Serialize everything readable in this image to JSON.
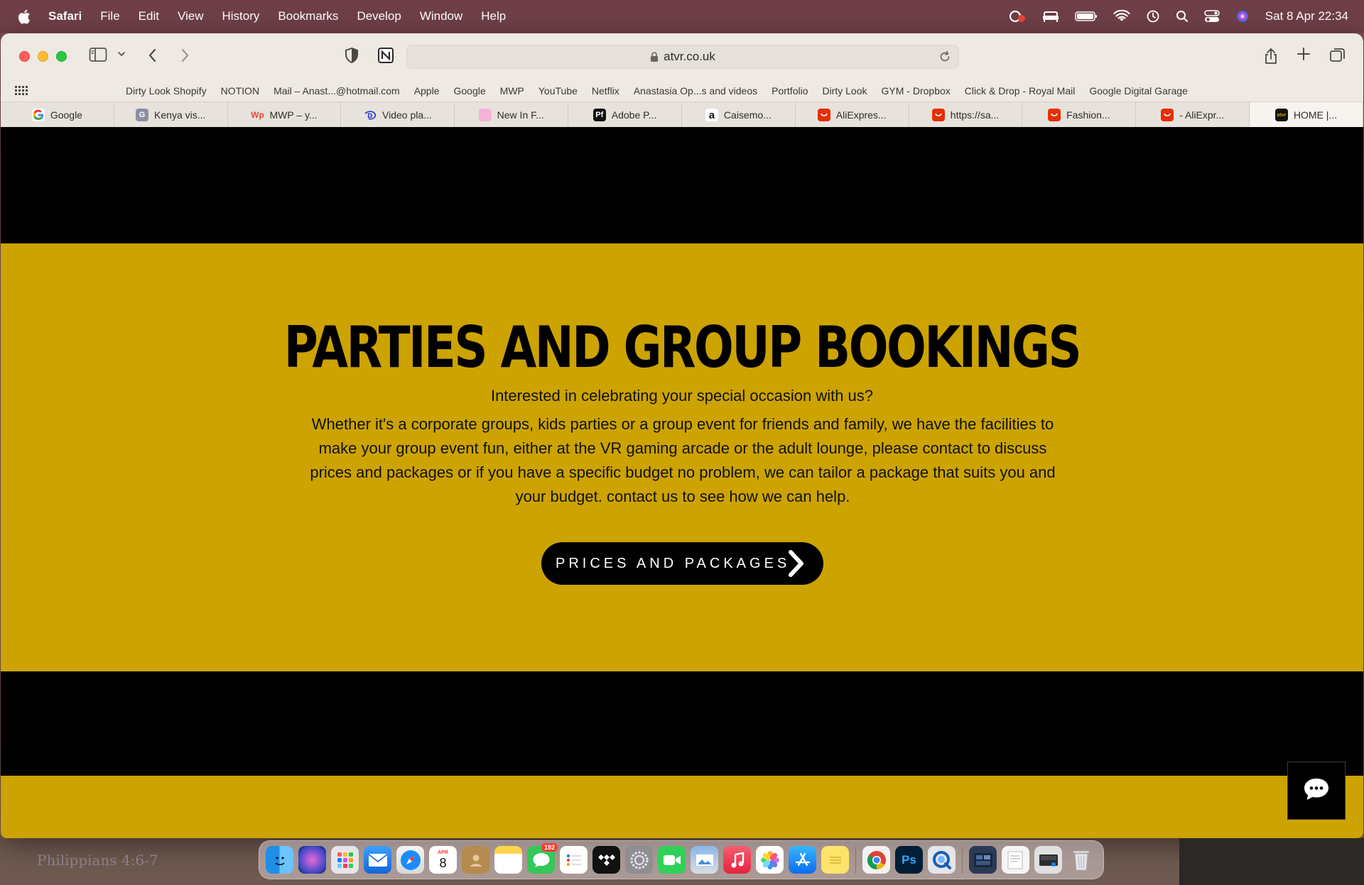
{
  "menubar": {
    "app_name": "Safari",
    "items": [
      "File",
      "Edit",
      "View",
      "History",
      "Bookmarks",
      "Develop",
      "Window",
      "Help"
    ],
    "clock": "Sat 8 Apr  22:34"
  },
  "browser": {
    "address": "atvr.co.uk",
    "bookmarks": [
      "Dirty Look Shopify",
      "NOTION",
      "Mail – Anast...@hotmail.com",
      "Apple",
      "Google",
      "MWP",
      "YouTube",
      "Netflix",
      "Anastasia Op...s and videos",
      "Portfolio",
      "Dirty Look",
      "GYM - Dropbox",
      "Click & Drop - Royal Mail",
      "Google Digital Garage"
    ],
    "tabs": [
      {
        "label": "Google",
        "icon": "google-icon",
        "color": "#ffffff"
      },
      {
        "label": "Kenya vis...",
        "icon": "g-letter-icon",
        "color": "#8d8fa6"
      },
      {
        "label": "MWP – y...",
        "icon": "mwp-icon",
        "color": "#e8453c"
      },
      {
        "label": "Video pla...",
        "icon": "disney-icon",
        "color": "#2b3fd6"
      },
      {
        "label": "New In F...",
        "icon": "pink-square-icon",
        "color": "#f5b4d6"
      },
      {
        "label": "Adobe P...",
        "icon": "pf-icon",
        "color": "#111111"
      },
      {
        "label": "Caisemo...",
        "icon": "amazon-icon",
        "color": "#ffffff"
      },
      {
        "label": "AliExpres...",
        "icon": "aliexpress-icon",
        "color": "#e62e04"
      },
      {
        "label": "https://sa...",
        "icon": "aliexpress-icon",
        "color": "#e62e04"
      },
      {
        "label": "Fashion...",
        "icon": "aliexpress-icon",
        "color": "#e62e04"
      },
      {
        "label": "- AliExpr...",
        "icon": "aliexpress-icon",
        "color": "#e62e04"
      },
      {
        "label": "HOME |...",
        "icon": "atvr-icon",
        "color": "#111111"
      }
    ]
  },
  "page": {
    "heading": "PARTIES AND GROUP BOOKINGS",
    "lead": "Interested in celebrating your special occasion with us?",
    "body": "Whether it's a corporate groups, kids parties or a group event for friends and family, we have the facilities to make your group event fun, either at the VR gaming arcade or the adult lounge, please contact to discuss prices and packages or if you have a specific budget no problem, we can tailor a package that suits you and your budget. contact us to see how we can help.",
    "cta_label": "PRICES AND PACKAGES",
    "accent_color": "#cca300"
  },
  "desktop": {
    "note": "Philippians 4:6-7"
  },
  "dock": {
    "calendar_month": "APR",
    "calendar_day": "8",
    "messages_badge": "192",
    "photoshop_label": "Ps"
  }
}
